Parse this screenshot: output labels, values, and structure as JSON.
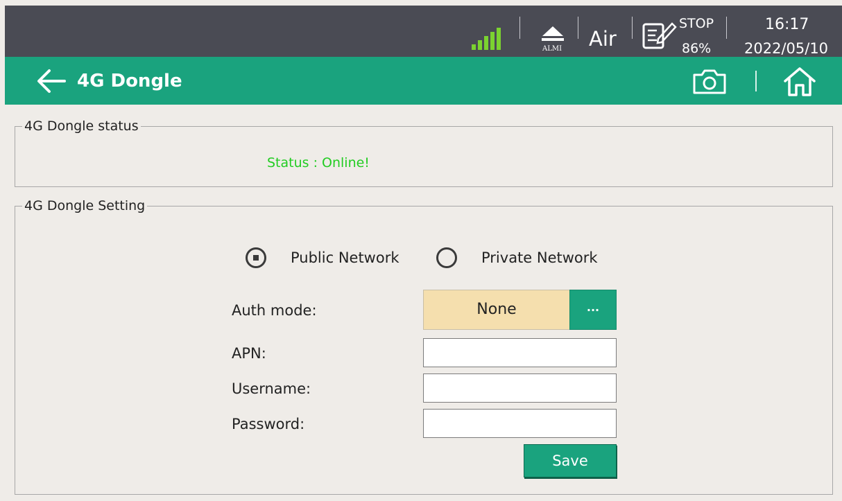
{
  "status_bar": {
    "signal_icon": "signal-bars-icon",
    "almi_label": "ALMI",
    "mode": "Air",
    "run_state": "STOP",
    "percent": "86%",
    "time": "16:17",
    "date": "2022/05/10",
    "colors": {
      "background": "#4a4b54",
      "signal": "#7bd330"
    }
  },
  "title_bar": {
    "title": "4G Dongle",
    "back_icon": "arrow-left-icon",
    "camera_icon": "camera-icon",
    "home_icon": "home-icon",
    "colors": {
      "background": "#1aa37e"
    }
  },
  "status_group": {
    "legend": "4G Dongle status",
    "status_text": "Status : Online!",
    "status_color": "#22cc22"
  },
  "setting_group": {
    "legend": "4G Dongle  Setting",
    "network_options": [
      {
        "label": "Public Network",
        "selected": true
      },
      {
        "label": "Private Network",
        "selected": false
      }
    ],
    "auth_mode": {
      "label": "Auth mode:",
      "value": "None",
      "button": "..."
    },
    "apn": {
      "label": "APN:",
      "value": ""
    },
    "username": {
      "label": "Username:",
      "value": ""
    },
    "password": {
      "label": "Password:",
      "value": ""
    },
    "save_label": "Save"
  }
}
